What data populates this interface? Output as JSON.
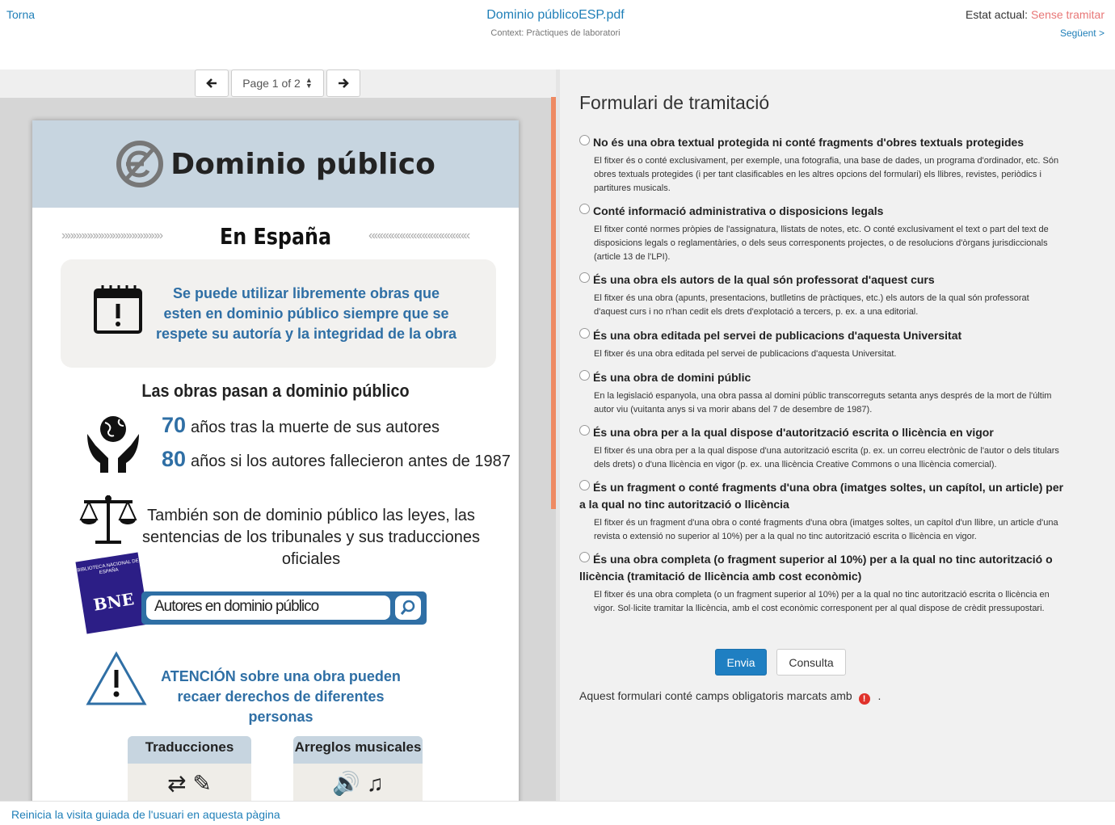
{
  "header": {
    "back_label": "Torna",
    "doc_title": "Dominio públicoESP.pdf",
    "context": "Context: Pràctiques de laboratori",
    "status_label": "Estat actual:",
    "status_value": "Sense tramitar",
    "status_color": "#e87777",
    "next_label": "Següent >"
  },
  "viewer": {
    "page_select": "Page 1 of 2",
    "prev_icon": "arrow-left-icon",
    "next_icon": "arrow-right-icon"
  },
  "pdf": {
    "title": "Dominio público",
    "subtitle": "En España",
    "info": "Se puede utilizar libremente obras que esten en dominio público siempre que se respete su autoría y la integridad de la obra",
    "obras_title": "Las obras pasan a dominio público",
    "years": [
      {
        "num": "70",
        "text": "años tras la muerte de sus autores"
      },
      {
        "num": "80",
        "text": "años si los autores fallecieron antes de 1987"
      }
    ],
    "also": "También son de dominio público las leyes, las sentencias de los tribunales y sus traducciones oficiales",
    "bne_small": "BIBLIOTECA NACIONAL DE ESPAÑA",
    "bne_big": "BNE",
    "search_text": "Autores en dominio público",
    "atencion": "ATENCIÓN sobre una obra pueden recaer derechos de diferentes personas",
    "card1": "Traducciones",
    "card2": "Arreglos musicales",
    "accent_color": "#2f6fa5"
  },
  "form": {
    "title": "Formulari de tramitació",
    "options": [
      {
        "label": "No és una obra textual protegida ni conté fragments d'obres textuals protegides",
        "desc": "El fitxer és o conté exclusivament, per exemple, una fotografia, una base de dades, un programa d'ordinador, etc. Són obres textuals protegides (i per tant clasificables en les altres opcions del formulari) els llibres, revistes, periòdics i partitures musicals."
      },
      {
        "label": "Conté informació administrativa o disposicions legals",
        "desc": "El fitxer conté normes pròpies de l'assignatura, llistats de notes, etc. O conté exclusivament el text o part del text de disposicions legals o reglamentàries, o dels seus corresponents projectes, o de resolucions d'òrgans jurisdiccionals (article 13 de l'LPI)."
      },
      {
        "label": "És una obra els autors de la qual són professorat d'aquest curs",
        "desc": "El fitxer és una obra (apunts, presentacions, butlletins de pràctiques, etc.) els autors de la qual són professorat d'aquest curs i no n'han cedit els drets d'explotació a tercers, p. ex. a una editorial."
      },
      {
        "label": "És una obra editada pel servei de publicacions d'aquesta Universitat",
        "desc": "El fitxer és una obra editada pel servei de publicacions d'aquesta Universitat."
      },
      {
        "label": "És una obra de domini públic",
        "desc": "En la legislació espanyola, una obra passa al domini públic transcorreguts setanta anys després de la mort de l'últim autor viu (vuitanta anys si va morir abans del 7 de desembre de 1987)."
      },
      {
        "label": "És una obra per a la qual dispose d'autorització escrita o llicència en vigor",
        "desc": "El fitxer és una obra per a la qual dispose d'una autorització escrita (p. ex. un correu electrònic de l'autor o dels titulars dels drets) o d'una llicència en vigor (p. ex. una llicència Creative Commons o una llicència comercial)."
      },
      {
        "label": "És un fragment o conté fragments d'una obra (imatges soltes, un capítol, un article) per a la qual no tinc autorització o llicència",
        "desc": "El fitxer és un fragment d'una obra o conté fragments d'una obra (imatges soltes, un capítol d'un llibre, un article d'una revista o extensió no superior al 10%) per a la qual no tinc autorització escrita o llicència en vigor."
      },
      {
        "label": "És una obra completa (o fragment superior al 10%) per a la qual no tinc autorització o llicència (tramitació de llicència amb cost econòmic)",
        "desc": "El fitxer és una obra completa (o un fragment superior al 10%) per a la qual no tinc autorització escrita o llicència en vigor. Sol·licite tramitar la llicència, amb el cost econòmic corresponent per al qual dispose de crèdit pressupostari."
      }
    ],
    "send_label": "Envia",
    "consult_label": "Consulta",
    "required_note": "Aquest formulari conté camps obligatoris marcats amb",
    "required_end": ".",
    "button_color": "#1f7fc2"
  },
  "footer": {
    "tour_label": "Reinicia la visita guiada de l'usuari en aquesta pàgina"
  }
}
